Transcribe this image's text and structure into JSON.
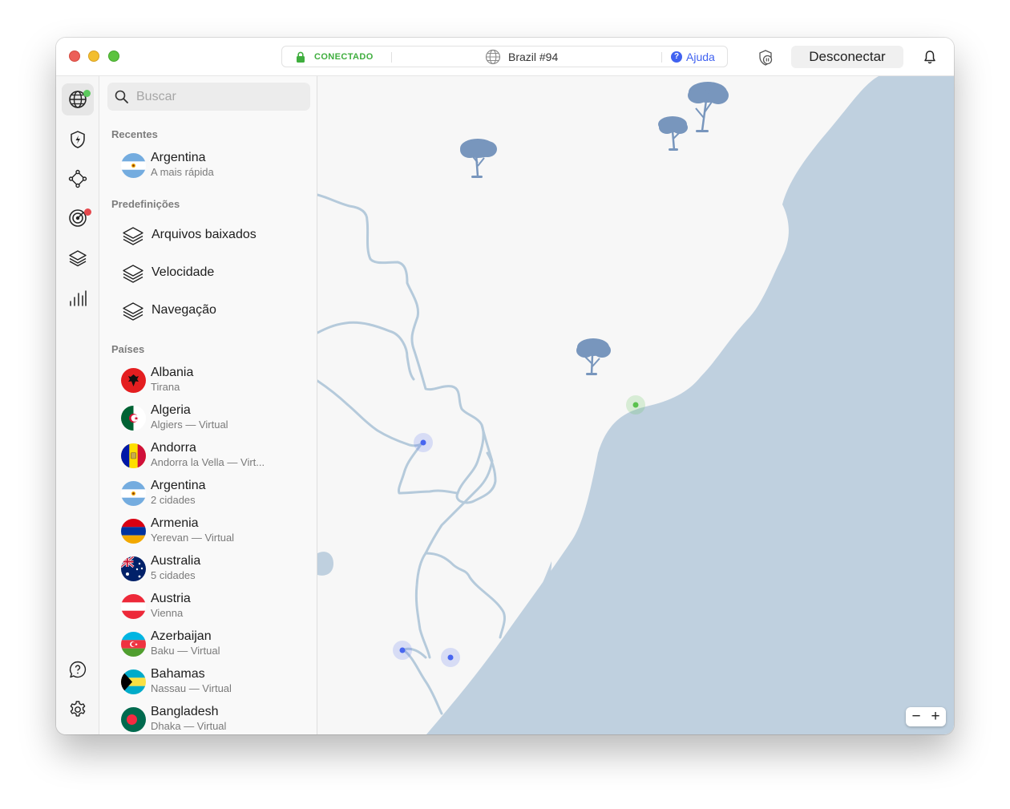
{
  "titlebar": {
    "status": "CONECTADO",
    "server": "Brazil #94",
    "help_label": "Ajuda",
    "disconnect_label": "Desconectar",
    "colors": {
      "connected": "#3fae3e",
      "accent": "#4062f0"
    }
  },
  "rail": {
    "items": [
      {
        "name": "globe-icon",
        "active": true,
        "badge": "green"
      },
      {
        "name": "threat-protection-icon"
      },
      {
        "name": "meshnet-icon"
      },
      {
        "name": "target-icon",
        "badge": "red"
      },
      {
        "name": "layers-icon"
      },
      {
        "name": "stats-icon"
      }
    ],
    "bottom": [
      {
        "name": "help-chat-icon"
      },
      {
        "name": "settings-gear-icon"
      }
    ]
  },
  "sidebar": {
    "search_placeholder": "Buscar",
    "recent_label": "Recentes",
    "recent": [
      {
        "title": "Argentina",
        "subtitle": "A mais rápida",
        "flag": "argentina"
      }
    ],
    "presets_label": "Predefinições",
    "presets": [
      {
        "title": "Arquivos baixados"
      },
      {
        "title": "Velocidade"
      },
      {
        "title": "Navegação"
      }
    ],
    "countries_label": "Países",
    "countries": [
      {
        "title": "Albania",
        "subtitle": "Tirana",
        "flag": "albania"
      },
      {
        "title": "Algeria",
        "subtitle": "Algiers — Virtual",
        "flag": "algeria"
      },
      {
        "title": "Andorra",
        "subtitle": "Andorra la Vella — Virt...",
        "flag": "andorra"
      },
      {
        "title": "Argentina",
        "subtitle": "2 cidades",
        "flag": "argentina"
      },
      {
        "title": "Armenia",
        "subtitle": "Yerevan — Virtual",
        "flag": "armenia"
      },
      {
        "title": "Australia",
        "subtitle": "5 cidades",
        "flag": "australia"
      },
      {
        "title": "Austria",
        "subtitle": "Vienna",
        "flag": "austria"
      },
      {
        "title": "Azerbaijan",
        "subtitle": "Baku — Virtual",
        "flag": "azerbaijan"
      },
      {
        "title": "Bahamas",
        "subtitle": "Nassau — Virtual",
        "flag": "bahamas"
      },
      {
        "title": "Bangladesh",
        "subtitle": "Dhaka — Virtual",
        "flag": "bangladesh"
      }
    ]
  },
  "map": {
    "zoom_out": "−",
    "zoom_in": "+",
    "colors": {
      "land": "#f7f7f7",
      "sea": "#bfd0df",
      "border": "#b5cadb",
      "tree": "#7896bd",
      "pin": "#4866f0",
      "connected_pin": "#5bc24e"
    }
  }
}
